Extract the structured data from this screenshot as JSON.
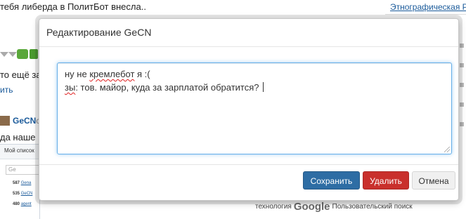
{
  "background": {
    "top_text": "тебя либерда в ПолитБот внесла..",
    "right_link": "Этнографическая Р",
    "line1": "то ещё за",
    "line2": "ить",
    "user_name": "GeCN",
    "user_tail": "c",
    "line3": "да наше",
    "mini_panel": {
      "title": "Мой список",
      "search_value": "Ge",
      "rows": [
        {
          "num": "587",
          "name": "Gena"
        },
        {
          "num": "535",
          "name": "GeCN"
        },
        {
          "num": "480",
          "name": "agent"
        }
      ]
    },
    "google_prefix": "технология",
    "google_brand": "Google",
    "google_suffix": "Пользовательский поиск"
  },
  "modal": {
    "title": "Редактирование GeCN",
    "editor": {
      "line1_before": "ну не ",
      "line1_misspelled": "кремлебот",
      "line1_after": " я :(",
      "line2_misspelled": "зы",
      "line2_after": ": тов. майор, куда за зарплатой обратится?"
    },
    "buttons": {
      "save": "Сохранить",
      "delete": "Удалить",
      "cancel": "Отмена"
    }
  },
  "colors": {
    "save": "#2e6da4",
    "delete": "#c9302c",
    "cancel": "#f0f0f0",
    "focus": "#66afe9",
    "link": "#1a5a9a"
  }
}
